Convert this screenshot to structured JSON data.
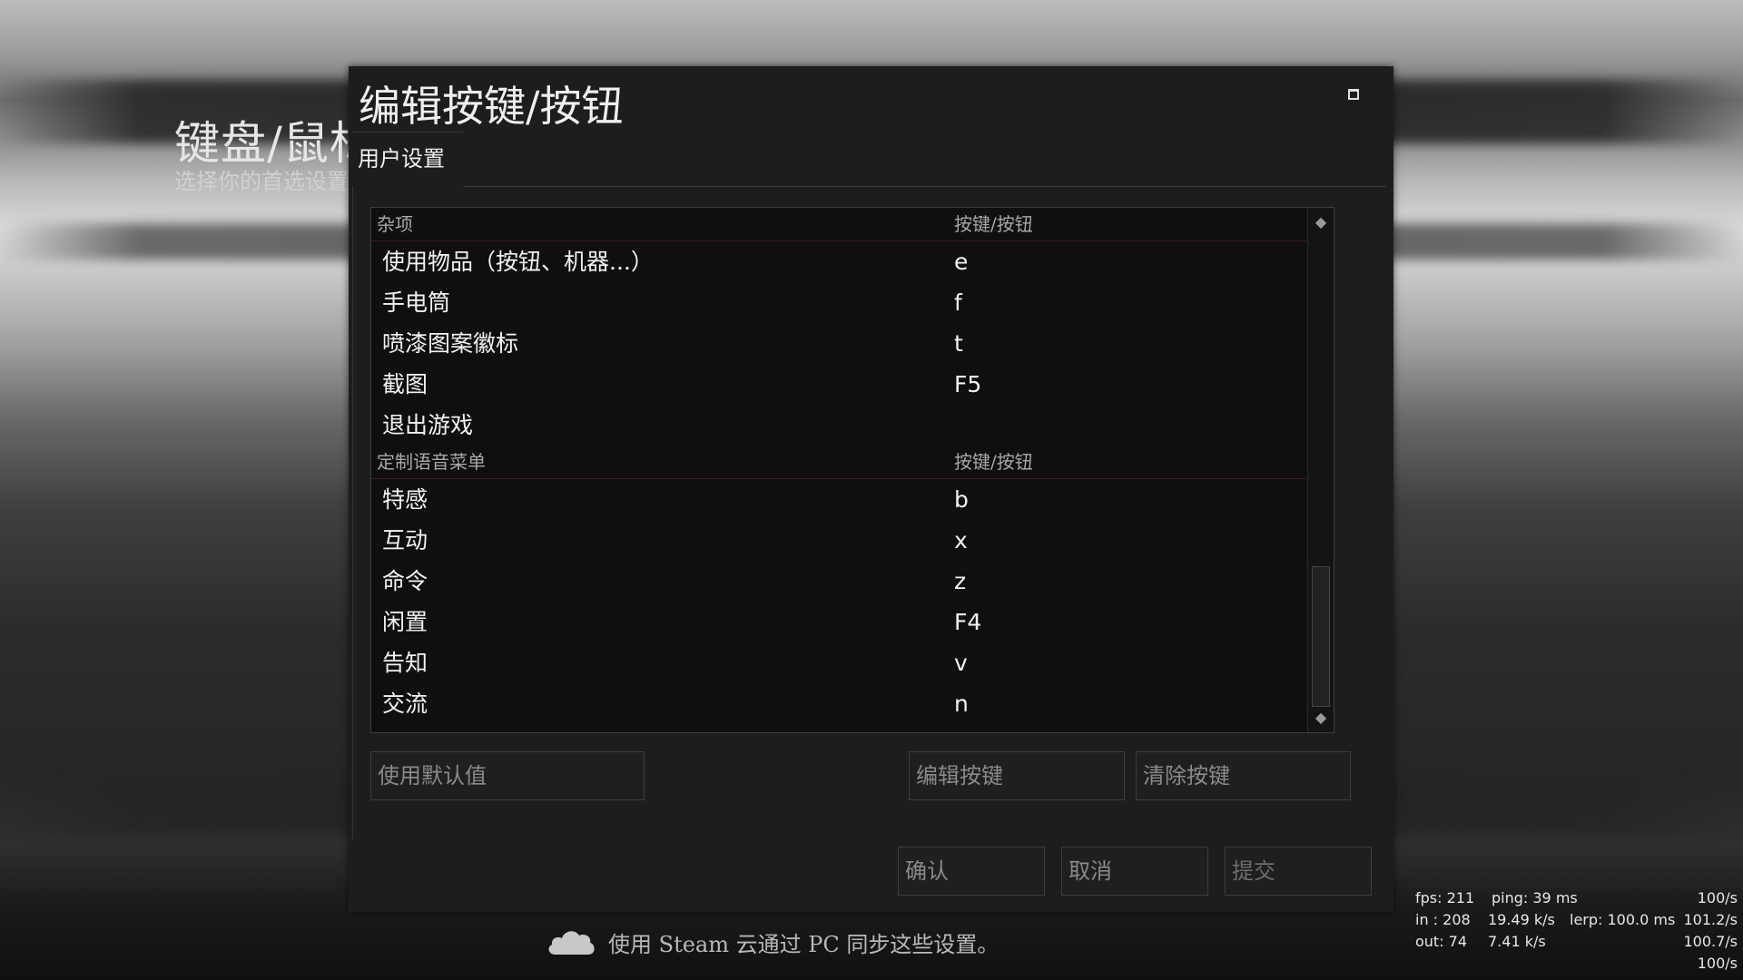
{
  "background": {
    "title": "键盘/鼠标",
    "subtitle": "选择你的首选设置"
  },
  "dialog": {
    "title": "编辑按键/按钮",
    "tab_label": "用户设置"
  },
  "list": {
    "sections": [
      {
        "header": {
          "action": "杂项",
          "key": "按键/按钮"
        },
        "rows": [
          {
            "action": "使用物品（按钮、机器...）",
            "key": "e"
          },
          {
            "action": "手电筒",
            "key": "f"
          },
          {
            "action": "喷漆图案徽标",
            "key": "t"
          },
          {
            "action": "截图",
            "key": "F5"
          },
          {
            "action": "退出游戏",
            "key": ""
          }
        ]
      },
      {
        "header": {
          "action": "定制语音菜单",
          "key": "按键/按钮"
        },
        "rows": [
          {
            "action": "特感",
            "key": "b"
          },
          {
            "action": "互动",
            "key": "x"
          },
          {
            "action": "命令",
            "key": "z"
          },
          {
            "action": "闲置",
            "key": "F4"
          },
          {
            "action": "告知",
            "key": "v"
          },
          {
            "action": "交流",
            "key": "n"
          }
        ]
      }
    ]
  },
  "buttons": {
    "use_defaults": "使用默认值",
    "edit_key": "编辑按键",
    "clear_key": "清除按键",
    "ok": "确认",
    "cancel": "取消",
    "apply": "提交"
  },
  "steam_note": "使用 Steam 云通过 PC 同步这些设置。",
  "netgraph": {
    "fps": "fps: 211",
    "ping": "ping: 39 ms",
    "rate1": "100/s",
    "in_label": "in : 208",
    "in_kbs": "19.49 k/s",
    "lerp": "lerp: 100.0 ms",
    "rate2": "101.2/s",
    "out_label": "out:  74",
    "out_kbs": "7.41 k/s",
    "rate3": "100.7/s",
    "rate4": "100/s"
  },
  "icons": {
    "cloud": "steam-cloud-icon",
    "restore": "window-restore-icon",
    "scroll_up": "scroll-up-arrow-icon",
    "scroll_down": "scroll-down-arrow-icon"
  }
}
